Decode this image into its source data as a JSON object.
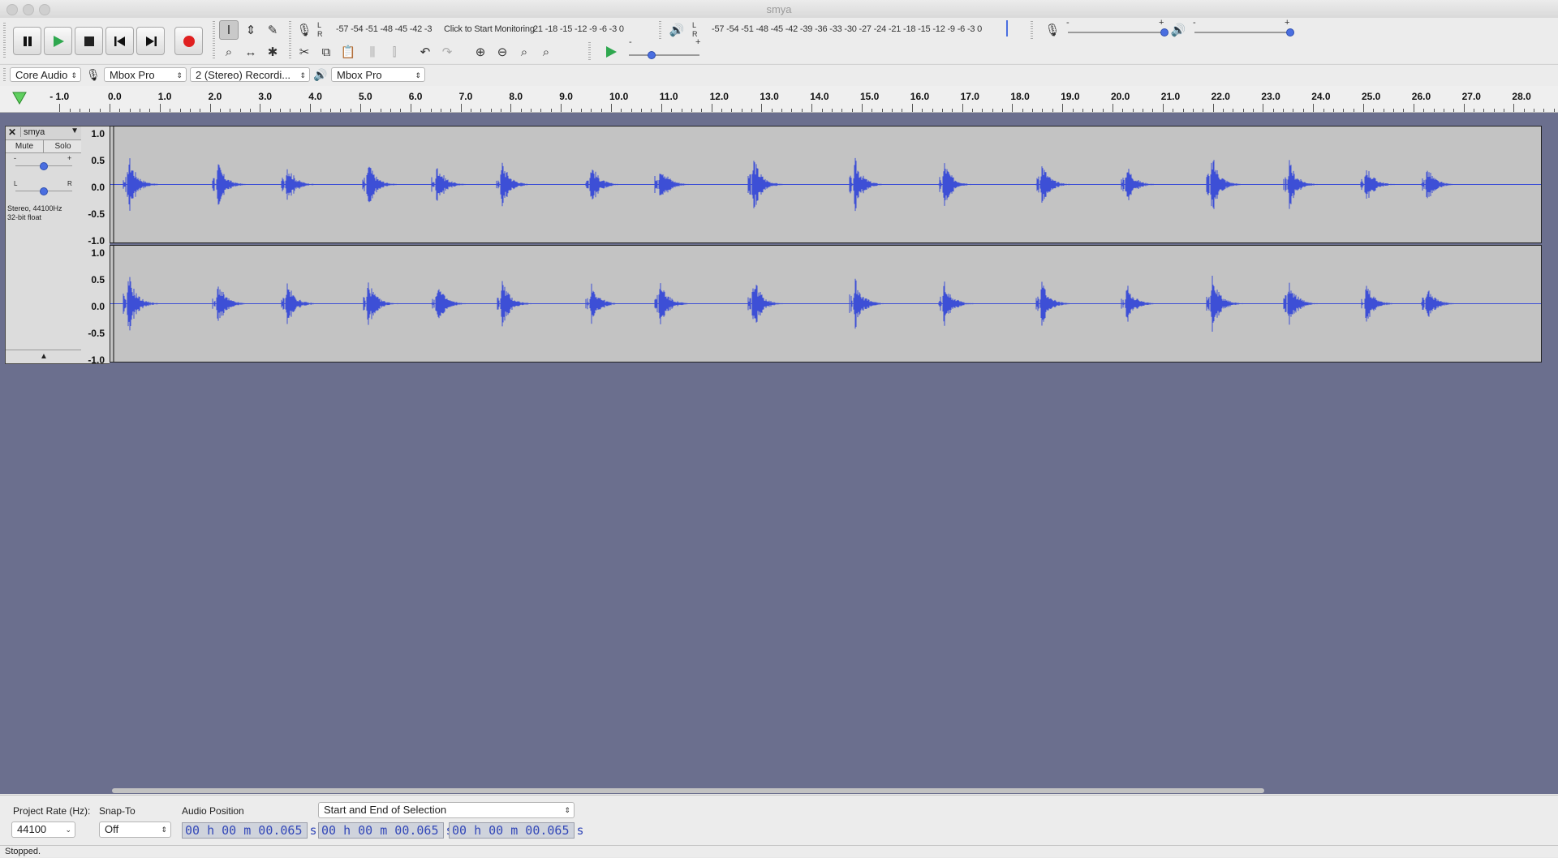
{
  "window": {
    "title": "smya"
  },
  "transport": {
    "pause": "pause-icon",
    "play": "play-icon",
    "stop": "stop-icon",
    "skip_start": "skip-to-start-icon",
    "skip_end": "skip-to-end-icon",
    "record": "record-icon",
    "play_color": "#2fa84f",
    "record_color": "#e02020"
  },
  "meters": {
    "record_scale": "-57 -54 -51 -48 -45 -42 -3",
    "record_hint": "Click to Start Monitoring",
    "record_scale_tail": "21 -18 -15 -12 -9 -6 -3 0",
    "record_channels": [
      "L",
      "R"
    ],
    "play_scale": "-57 -54 -51 -48 -45 -42 -39 -36 -33 -30 -27 -24 -21 -18 -15 -12 -9 -6 -3 0",
    "play_channels": [
      "L",
      "R"
    ]
  },
  "mixer": {
    "minus": "-",
    "plus": "+"
  },
  "devices": {
    "host": "Core Audio",
    "recording_device": "Mbox Pro",
    "recording_channels": "2 (Stereo) Recordi...",
    "playback_device": "Mbox Pro"
  },
  "ruler": {
    "labels": [
      "- 1.0",
      "0.0",
      "1.0",
      "2.0",
      "3.0",
      "4.0",
      "5.0",
      "6.0",
      "7.0",
      "8.0",
      "9.0",
      "10.0",
      "11.0",
      "12.0",
      "13.0",
      "14.0",
      "15.0",
      "16.0",
      "17.0",
      "18.0",
      "19.0",
      "20.0",
      "21.0",
      "22.0",
      "23.0",
      "24.0",
      "25.0",
      "26.0",
      "27.0",
      "28.0"
    ]
  },
  "track": {
    "name": "smya",
    "mute": "Mute",
    "solo": "Solo",
    "gain_minus": "-",
    "gain_plus": "+",
    "pan_left": "L",
    "pan_right": "R",
    "info_rate": "Stereo, 44100Hz",
    "info_format": "32-bit float",
    "scale": [
      "1.0",
      "0.5",
      "0.0",
      "-0.5",
      "-1.0"
    ]
  },
  "selection_bar": {
    "project_rate_label": "Project Rate (Hz):",
    "project_rate": "44100",
    "snap_label": "Snap-To",
    "snap_value": "Off",
    "audio_position_label": "Audio Position",
    "audio_position": "00 h 00 m 00.065 s",
    "selection_mode": "Start and End of Selection",
    "selection_start": "00 h 00 m 00.065 s",
    "selection_end": "00 h 00 m 00.065 s"
  },
  "status": {
    "text": "Stopped."
  },
  "colors": {
    "waveform": "#3d4fd6",
    "workspace": "#6b6f8e",
    "track_bg": "#c3c3c3"
  }
}
